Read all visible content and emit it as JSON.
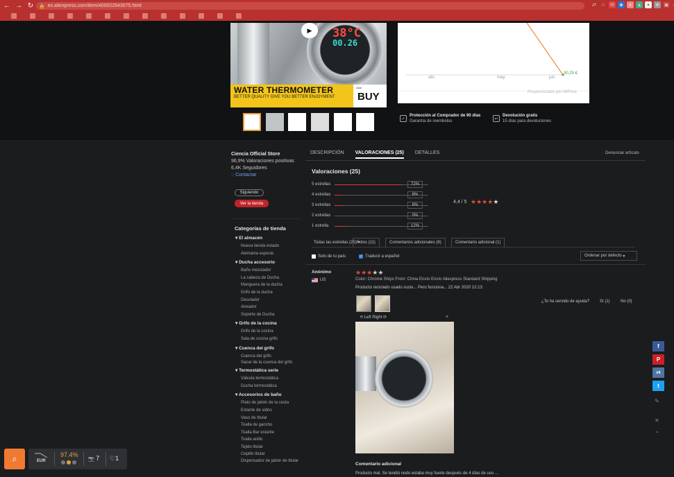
{
  "browser": {
    "url": "es.aliexpress.com/item/4000226435?5.html",
    "bookmarks": [
      "",
      "",
      "",
      "",
      "",
      "",
      "",
      "",
      "",
      "",
      "",
      "",
      ""
    ]
  },
  "product": {
    "lcd_temp": "38°C",
    "lcd_flow": "00.26",
    "banner_title": "WATER THERMOMETER",
    "banner_sub": "BETTER QUALITY GIVE YOU BETTER ENJOYMENT",
    "buy_small": "click",
    "buy_label": "BUY",
    "thumbs": [
      "",
      "",
      "",
      "",
      "",
      ""
    ]
  },
  "price_chart": {
    "ticks": [
      "abr.",
      "may.",
      "jun."
    ],
    "last_value": "30,25 €",
    "powered": "Proporcionado por AliPrice"
  },
  "protection": [
    {
      "title": "Protección al Comprador de 90 días",
      "sub": "Garantía de reembolso"
    },
    {
      "title": "Devolución gratis",
      "sub": "15 días para devoluciones"
    }
  ],
  "store": {
    "name": "Ciencia Official Store",
    "positive": "96,9% Valoraciones positivas",
    "followers": "6,4K Seguidores",
    "contact": "Contactar",
    "follow_btn": "Siguiendo",
    "visit_btn": "Ver la tienda"
  },
  "categories": {
    "title": "Categorías de tienda",
    "groups": [
      {
        "name": "El almacén",
        "items": [
          "Nueva tienda estado",
          "Alemania especie"
        ]
      },
      {
        "name": "Ducha accesorio",
        "items": [
          "Baño mezclador",
          "La cabeza de Ducha",
          "Manguera de la ducha",
          "Grifo de la ducha",
          "Desviador",
          "Aireador",
          "Soporte de Ducha"
        ]
      },
      {
        "name": "Grifo de la cocina",
        "items": [
          "Grifo de la cocina",
          "Sala de cocina grifo"
        ]
      },
      {
        "name": "Cuenca del grifo",
        "items": [
          "Cuenca del grifo",
          "Sacar de la cuenca del grifo"
        ]
      },
      {
        "name": "Termostática serie",
        "items": [
          "Válvula termostática",
          "Ducha termostática"
        ]
      },
      {
        "name": "Accesorios de baño",
        "items": [
          "Plato de jabón de la cesta",
          "Estante de vidrio",
          "Vaso de titular",
          "Toalla de gancho",
          "Toalla Bar estante",
          "Toalla anillo",
          "Tejido titular",
          "Cepillo titular",
          "Dispensador de jabón de titular"
        ]
      }
    ]
  },
  "reviews": {
    "tabs": [
      "DESCRIPCIÓN",
      "VALORACIONES (25)",
      "DETALLES"
    ],
    "report": "Denunciar artículo",
    "title": "Valoraciones (25)",
    "rows": [
      {
        "label": "5 estrellas",
        "pct": "72%",
        "fill": 0.72
      },
      {
        "label": "4 estrellas",
        "pct": "8%",
        "fill": 0.08
      },
      {
        "label": "3 estrellas",
        "pct": "8%",
        "fill": 0.08
      },
      {
        "label": "2 estrellas",
        "pct": "0%",
        "fill": 0
      },
      {
        "label": "1 estrella",
        "pct": "12%",
        "fill": 0.12
      }
    ],
    "average": "4,4 / 5",
    "filters": [
      "Todas las estrellas (25)",
      "Fotos (11)",
      "Comentarios adicionales (8)",
      "Comentario adicional (1)"
    ],
    "only_country": "Solo de tu país",
    "translate": "Traducir a español",
    "sort": "Ordenar por defecto",
    "item": {
      "author": "Anónimo",
      "country": "US",
      "meta": "Color: Chrome    Ships From: China    Envío Envío Aliexpress Standard Shipping",
      "text": "Producto reciclado usado sucio... Pero funciona...   22 Abr 2020 12:13",
      "helpful": "¿Te ha servido de ayuda?",
      "yes": "Sí (1)",
      "no": "No (0)",
      "rotate": "Left   Right",
      "close": "×",
      "additional_title": "Comentario adicional",
      "additional_text": "Producto mal. Se tendió nodo estaba muy fuerte después de 4 días de uso ..."
    }
  },
  "social": [
    "f",
    "P",
    "vk",
    "t"
  ],
  "widget": {
    "currency": "EUR",
    "rating": "97.4%",
    "camera_count": "7",
    "heart_count": "1"
  }
}
